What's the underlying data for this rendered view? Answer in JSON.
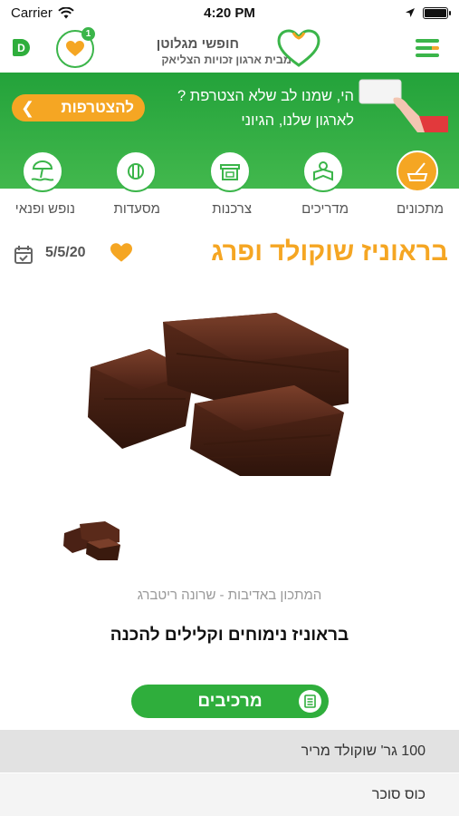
{
  "status": {
    "carrier": "Carrier",
    "time": "4:20 PM",
    "battery_level": 1.0
  },
  "header": {
    "brand_badge": "D",
    "favorites_count": "1",
    "logo_title": "חופשי מגלוטן",
    "logo_subtitle": "מבית ארגון זכויות הצליאק"
  },
  "banner": {
    "text": "הי, שמנו לב שלא הצטרפת ? לארגון שלנו, הגיוני",
    "join_label": "להצטרפות"
  },
  "categories": [
    {
      "label": "מתכונים",
      "icon": "recipes-icon",
      "active": true
    },
    {
      "label": "מדריכים",
      "icon": "guides-icon",
      "active": false
    },
    {
      "label": "צרכנות",
      "icon": "shop-icon",
      "active": false
    },
    {
      "label": "מסעדות",
      "icon": "restaurant-icon",
      "active": false
    },
    {
      "label": "נופש ופנאי",
      "icon": "leisure-icon",
      "active": false
    }
  ],
  "recipe": {
    "title": "בראוניז שוקולד ופרג",
    "date": "5/5/20",
    "credit": "המתכון באדיבות - שרונה ריטברג",
    "subtitle": "בראוניז נימוחים וקלילים להכנה",
    "ingredients_label": "מרכיבים",
    "ingredients": [
      "100 גר' שוקולד מריר",
      "כוס סוכר"
    ]
  },
  "colors": {
    "green": "#3bb54a",
    "orange": "#f5a623"
  }
}
